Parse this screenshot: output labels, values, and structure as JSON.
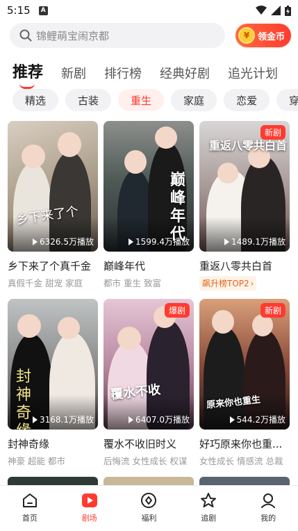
{
  "status_bar": {
    "time": "5:15",
    "notif_letter": "A"
  },
  "search": {
    "placeholder": "锦鲤萌宝闹京都"
  },
  "coin_button": {
    "symbol": "¥",
    "label": "领金币"
  },
  "tabs": [
    {
      "label": "推荐",
      "active": true
    },
    {
      "label": "新剧"
    },
    {
      "label": "排行榜"
    },
    {
      "label": "经典好剧"
    },
    {
      "label": "追光计划"
    }
  ],
  "chips": [
    {
      "label": "精选"
    },
    {
      "label": "古装"
    },
    {
      "label": "重生",
      "active": true
    },
    {
      "label": "家庭"
    },
    {
      "label": "恋爱"
    },
    {
      "label": "穿越"
    }
  ],
  "cards": [
    {
      "title": "乡下来了个真千金",
      "tags": "真假千金 甜宠 家庭",
      "plays": "6326.5万播放",
      "badge": "",
      "art_text": "乡下来了个",
      "rank": ""
    },
    {
      "title": "巅峰年代",
      "tags": "都市 重生 致富",
      "plays": "1599.4万播放",
      "badge": "",
      "art_text": "巅峰年代",
      "rank": ""
    },
    {
      "title": "重返八零共白首",
      "tags": "",
      "plays": "1489.1万播放",
      "badge": "新剧",
      "art_text": "重返八零共白首",
      "rank": "飙升榜TOP2"
    },
    {
      "title": "封神奇缘",
      "tags": "神豪 超能 都市",
      "plays": "3168.1万播放",
      "badge": "",
      "art_text": "封神奇缘",
      "rank": ""
    },
    {
      "title": "覆水不收旧时义",
      "tags": "后悔流 女性成长 权谋",
      "plays": "6407.0万播放",
      "badge": "爆剧",
      "art_text": "覆水不收",
      "rank": ""
    },
    {
      "title": "好巧原来你也重...",
      "tags": "女性成长 情感流 总裁",
      "plays": "544.2万播放",
      "badge": "新剧",
      "art_text": "原来你也重生",
      "rank": ""
    }
  ],
  "bottom_nav": [
    {
      "label": "首页",
      "icon": "home-icon"
    },
    {
      "label": "剧场",
      "icon": "theater-play-icon",
      "active": true
    },
    {
      "label": "福利",
      "icon": "gift-icon"
    },
    {
      "label": "追剧",
      "icon": "star-follow-icon"
    },
    {
      "label": "我的",
      "icon": "profile-icon"
    }
  ],
  "colors": {
    "accent": "#ff3b30",
    "rank": "#e0661a"
  }
}
